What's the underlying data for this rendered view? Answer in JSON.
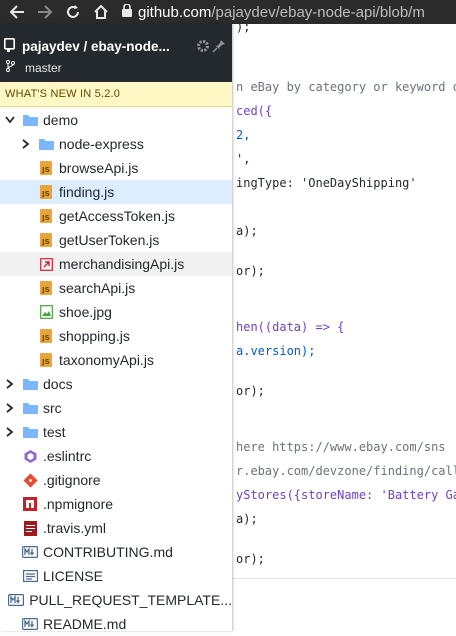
{
  "browser": {
    "url_host": "github.com",
    "url_path": "/pajaydev/ebay-node-api/blob/m"
  },
  "sidebar": {
    "repo_title": "pajaydev / ebay-node...",
    "branch": "master",
    "whats_new": "WHAT'S NEW IN 5.2.0",
    "tree": [
      {
        "label": "demo",
        "type": "folder",
        "expanded": true,
        "depth": 0
      },
      {
        "label": "node-express",
        "type": "folder",
        "expanded": false,
        "depth": 1
      },
      {
        "label": "browseApi.js",
        "type": "js",
        "depth": 1
      },
      {
        "label": "finding.js",
        "type": "js",
        "depth": 1,
        "selected": true
      },
      {
        "label": "getAccessToken.js",
        "type": "js",
        "depth": 1
      },
      {
        "label": "getUserToken.js",
        "type": "js",
        "depth": 1
      },
      {
        "label": "merchandisingApi.js",
        "type": "link",
        "depth": 1,
        "hovered": true
      },
      {
        "label": "searchApi.js",
        "type": "js",
        "depth": 1
      },
      {
        "label": "shoe.jpg",
        "type": "image",
        "depth": 1
      },
      {
        "label": "shopping.js",
        "type": "js",
        "depth": 1
      },
      {
        "label": "taxonomyApi.js",
        "type": "js",
        "depth": 1
      },
      {
        "label": "docs",
        "type": "folder",
        "expanded": false,
        "depth": 0
      },
      {
        "label": "src",
        "type": "folder",
        "expanded": false,
        "depth": 0
      },
      {
        "label": "test",
        "type": "folder",
        "expanded": false,
        "depth": 0
      },
      {
        "label": ".eslintrc",
        "type": "eslint",
        "depth": 0
      },
      {
        "label": ".gitignore",
        "type": "git",
        "depth": 0
      },
      {
        "label": ".npmignore",
        "type": "npm",
        "depth": 0
      },
      {
        "label": ".travis.yml",
        "type": "yml",
        "depth": 0
      },
      {
        "label": "CONTRIBUTING.md",
        "type": "md",
        "depth": 0
      },
      {
        "label": "LICENSE",
        "type": "text",
        "depth": 0
      },
      {
        "label": "PULL_REQUEST_TEMPLATE...",
        "type": "md",
        "depth": 0
      },
      {
        "label": "README.md",
        "type": "md",
        "depth": 0
      }
    ]
  },
  "code": {
    "lines": [
      ");",
      "n eBay by category or keyword o",
      "ced({",
      " 2,",
      "',",
      "ingType: 'OneDayShipping'",
      "a);",
      "or);",
      "hen((data) => {",
      "a.version);",
      "or);",
      " here https://www.ebay.com/sns",
      "r.ebay.com/devzone/finding/call",
      "yStores({storeName: 'Battery Ga",
      "a);",
      "or);"
    ]
  },
  "colors": {
    "sidebar_header": "#24292e",
    "selected_row": "#dbedff",
    "folder": "#79b8ff",
    "js_file": "#e8a53b",
    "whats_new_bg": "#fff8c5"
  }
}
